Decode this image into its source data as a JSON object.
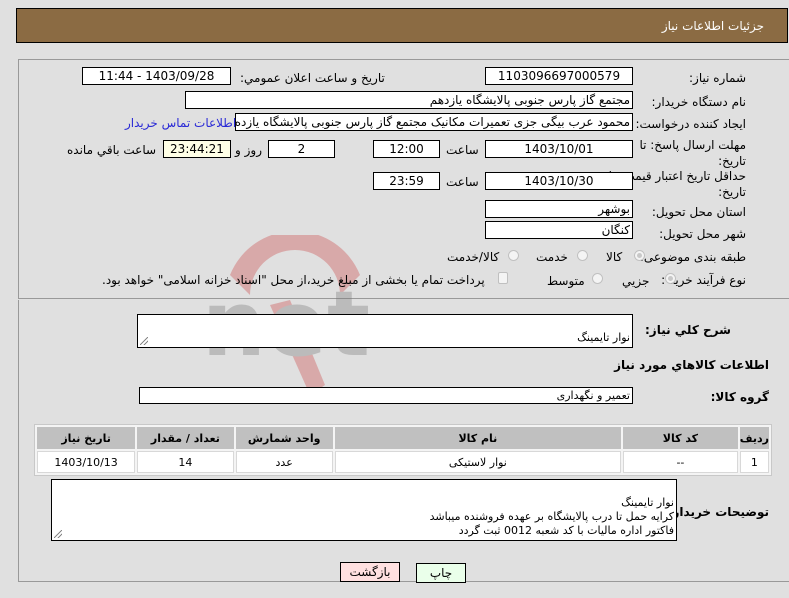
{
  "header": {
    "title": "جزئیات اطلاعات نیاز"
  },
  "form": {
    "need_number": {
      "label": "شماره نیاز:",
      "value": "1103096697000579"
    },
    "announce_datetime": {
      "label": "تاریخ و ساعت اعلان عمومي:",
      "value": "1403/09/28 - 11:44"
    },
    "buyer_org": {
      "label": "نام دستگاه خريدار:",
      "value": "مجتمع گاز پارس جنوبی  پالایشگاه یازدهم"
    },
    "requester": {
      "label": "ايجاد كننده درخواست:",
      "value": "محمود عرب بیگی جزی تعمیرات مکانیک مجتمع گاز پارس جنوبی  پالایشگاه یازده",
      "contact_link": "اطلاعات تماس خریدار"
    },
    "response_deadline": {
      "label": "مهلت ارسال پاسخ: تا تاریخ:",
      "date": "1403/10/01",
      "time_label": "ساعت",
      "time": "12:00",
      "days": "2",
      "days_label": "روز و",
      "remaining": "23:44:21",
      "remaining_label": "ساعت باقي مانده"
    },
    "price_validity": {
      "label": "حداقل تاریخ اعتبار قیمت: تا تاریخ:",
      "date": "1403/10/30",
      "time_label": "ساعت",
      "time": "23:59"
    },
    "delivery_province": {
      "label": "استان محل تحویل:",
      "value": "بوشهر"
    },
    "delivery_city": {
      "label": "شهر محل تحویل:",
      "value": "کنگان"
    },
    "category": {
      "label": "طبقه بندی موضوعی:",
      "options": [
        "کالا",
        "خدمت",
        "کالا/خدمت"
      ],
      "selected": "کالا"
    },
    "purchase_type": {
      "label": "نوع فرآیند خرید :",
      "options": [
        "جزیي",
        "متوسط"
      ],
      "selected": "جزیي",
      "treasury_note": "پرداخت تمام یا بخشی از مبلغ خرید،از محل \"اسناد خزانه اسلامی\" خواهد بود."
    }
  },
  "description": {
    "label": "شرح كلي نياز:",
    "value": "نوار تایمینگ"
  },
  "goods_section": {
    "title": "اطلاعات كالاهاي مورد نياز",
    "group_label": "گروه کالا:",
    "group_value": "تعمیر و نگهداری"
  },
  "table": {
    "headers": [
      "رديف",
      "کد کالا",
      "نام کالا",
      "واحد شمارش",
      "تعداد / مقدار",
      "تاریخ نیاز"
    ],
    "rows": [
      [
        "1",
        "--",
        "نوار لاستیکی",
        "عدد",
        "14",
        "1403/10/13"
      ]
    ]
  },
  "buyer_notes": {
    "label": "توضیحات خریدار:",
    "value": "نوار تایمینگ\nکرایه حمل  تا درب پالایشگاه بر عهده فروشنده میباشد\nفاکتور اداره مالیات با کد شعبه 0012 ثبت گردد"
  },
  "buttons": {
    "print": "چاپ",
    "back": "بازگشت"
  },
  "watermark": "AriaTender.net",
  "colors": {
    "header_bg": "#8b6b43",
    "link": "#2a2ad6",
    "print_bg": "#eaffea",
    "back_bg": "#ffe0e0"
  }
}
